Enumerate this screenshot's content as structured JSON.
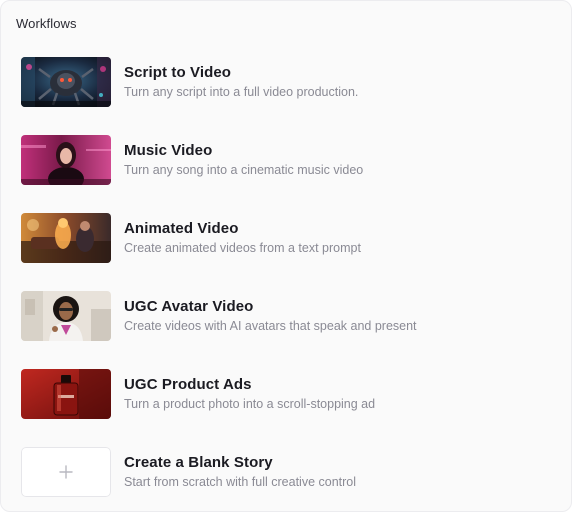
{
  "header": {
    "title": "Workflows"
  },
  "workflows": [
    {
      "title": "Script to Video",
      "description": "Turn any script into a full video production.",
      "thumbnail": "sci-fi-robot-image"
    },
    {
      "title": "Music Video",
      "description": "Turn any song into a cinematic music video",
      "thumbnail": "singer-pink-image"
    },
    {
      "title": "Animated Video",
      "description": "Create animated videos from a text prompt",
      "thumbnail": "animated-characters-image"
    },
    {
      "title": "UGC Avatar Video",
      "description": "Create videos with AI avatars that speak and present",
      "thumbnail": "avatar-woman-image"
    },
    {
      "title": "UGC Product Ads",
      "description": "Turn a product photo into a scroll-stopping ad",
      "thumbnail": "perfume-bottle-image"
    },
    {
      "title": "Create a Blank Story",
      "description": "Start from scratch with full creative control",
      "thumbnail": "plus-icon"
    }
  ],
  "colors": {
    "panel_bg": "#fafafa",
    "title_text": "#1b1b22",
    "description_text": "#8a8a94"
  }
}
